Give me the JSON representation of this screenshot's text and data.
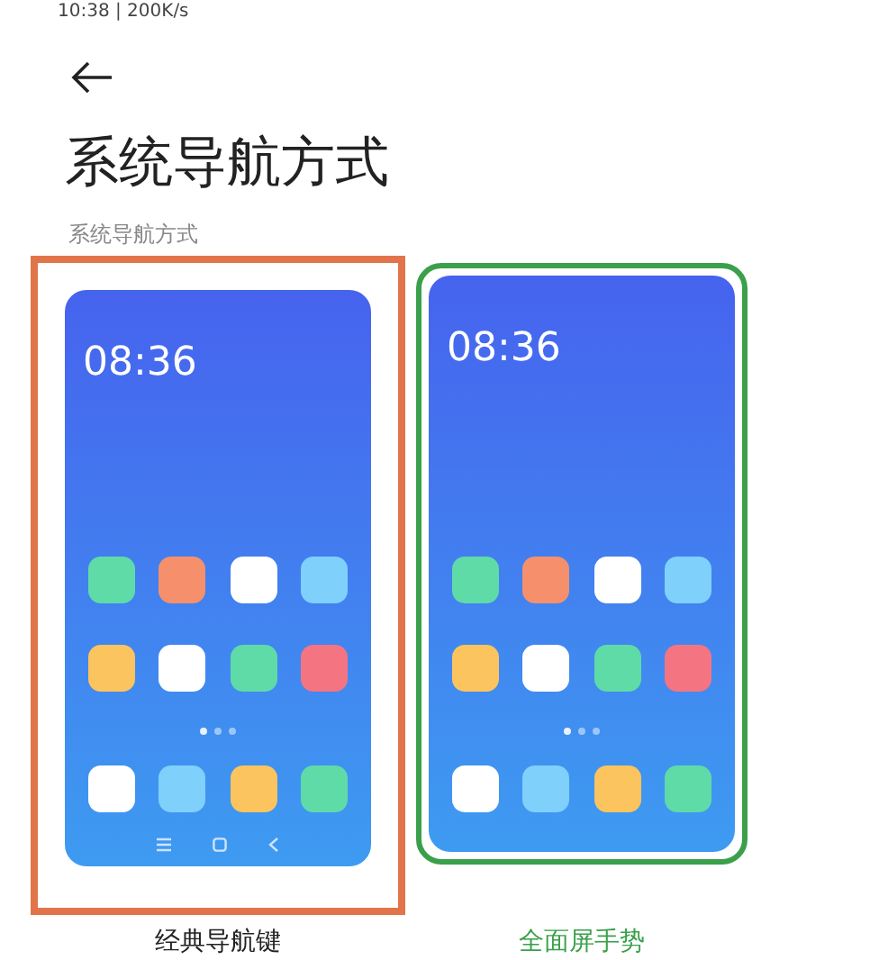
{
  "status_bar": {
    "text": "10:38 | 200K/s"
  },
  "title": "系统导航方式",
  "section_label": "系统导航方式",
  "options": [
    {
      "label": "经典导航键",
      "selected": false,
      "highlighted": true,
      "time": "08:36",
      "nav_bar": true,
      "apps": [
        {
          "color": "#5fdba8"
        },
        {
          "color": "#f6906c"
        },
        {
          "color": "#ffffff"
        },
        {
          "color": "#7fd0fb"
        },
        {
          "color": "#fcc45e"
        },
        {
          "color": "#ffffff"
        },
        {
          "color": "#5fdba8"
        },
        {
          "color": "#f57482"
        }
      ],
      "page_dots": [
        {
          "selected": true
        },
        {
          "selected": false
        },
        {
          "selected": false
        }
      ],
      "dock": [
        {
          "color": "#ffffff"
        },
        {
          "color": "#7fd0fb"
        },
        {
          "color": "#fcc45e"
        },
        {
          "color": "#5fdba8"
        }
      ]
    },
    {
      "label": "全面屏手势",
      "selected": true,
      "highlighted": false,
      "time": "08:36",
      "nav_bar": false,
      "apps": [
        {
          "color": "#5fdba8"
        },
        {
          "color": "#f6906c"
        },
        {
          "color": "#ffffff"
        },
        {
          "color": "#7fd0fb"
        },
        {
          "color": "#fcc45e"
        },
        {
          "color": "#ffffff"
        },
        {
          "color": "#5fdba8"
        },
        {
          "color": "#f57482"
        }
      ],
      "page_dots": [
        {
          "selected": true
        },
        {
          "selected": false
        },
        {
          "selected": false
        }
      ],
      "dock": [
        {
          "color": "#ffffff"
        },
        {
          "color": "#7fd0fb"
        },
        {
          "color": "#fcc45e"
        },
        {
          "color": "#5fdba8"
        }
      ]
    }
  ]
}
